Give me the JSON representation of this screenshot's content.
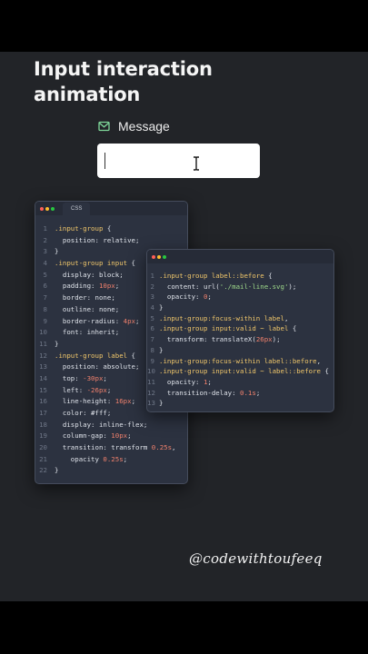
{
  "headline": {
    "line1": "Input interaction",
    "line2": "animation"
  },
  "demo": {
    "label": "Message",
    "label_icon": "mail-icon",
    "input_value": "",
    "cursor_icon": "i-beam-cursor-icon"
  },
  "colors": {
    "background": "#222428",
    "accent_icon": "#7fd89a",
    "window_bg": "#2c3240",
    "selector": "#f1c76a",
    "property": "#dfe3ea",
    "number": "#f0806c",
    "string": "#9ed98a"
  },
  "window1": {
    "tab_label": "CSS",
    "lines": [
      {
        "n": "1",
        "t": [
          {
            "c": "sel",
            "s": ".input-group"
          },
          {
            "c": "punc",
            "s": " {"
          }
        ]
      },
      {
        "n": "2",
        "t": [
          {
            "c": "prop",
            "s": "  position: "
          },
          {
            "c": "val",
            "s": "relative"
          },
          {
            "c": "punc",
            "s": ";"
          }
        ]
      },
      {
        "n": "3",
        "t": [
          {
            "c": "punc",
            "s": "}"
          }
        ]
      },
      {
        "n": "4",
        "t": [
          {
            "c": "sel",
            "s": ".input-group input"
          },
          {
            "c": "punc",
            "s": " {"
          }
        ]
      },
      {
        "n": "5",
        "t": [
          {
            "c": "prop",
            "s": "  display: "
          },
          {
            "c": "val",
            "s": "block"
          },
          {
            "c": "punc",
            "s": ";"
          }
        ]
      },
      {
        "n": "6",
        "t": [
          {
            "c": "prop",
            "s": "  padding: "
          },
          {
            "c": "num",
            "s": "10px"
          },
          {
            "c": "punc",
            "s": ";"
          }
        ]
      },
      {
        "n": "7",
        "t": [
          {
            "c": "prop",
            "s": "  border: "
          },
          {
            "c": "val",
            "s": "none"
          },
          {
            "c": "punc",
            "s": ";"
          }
        ]
      },
      {
        "n": "8",
        "t": [
          {
            "c": "prop",
            "s": "  outline: "
          },
          {
            "c": "val",
            "s": "none"
          },
          {
            "c": "punc",
            "s": ";"
          }
        ]
      },
      {
        "n": "9",
        "t": [
          {
            "c": "prop",
            "s": "  border-radius: "
          },
          {
            "c": "num",
            "s": "4px"
          },
          {
            "c": "punc",
            "s": ";"
          }
        ]
      },
      {
        "n": "10",
        "t": [
          {
            "c": "prop",
            "s": "  font: "
          },
          {
            "c": "val",
            "s": "inherit"
          },
          {
            "c": "punc",
            "s": ";"
          }
        ]
      },
      {
        "n": "11",
        "t": [
          {
            "c": "punc",
            "s": "}"
          }
        ]
      },
      {
        "n": "12",
        "t": [
          {
            "c": "sel",
            "s": ".input-group label"
          },
          {
            "c": "punc",
            "s": " {"
          }
        ]
      },
      {
        "n": "13",
        "t": [
          {
            "c": "prop",
            "s": "  position: "
          },
          {
            "c": "val",
            "s": "absolute"
          },
          {
            "c": "punc",
            "s": ";"
          }
        ]
      },
      {
        "n": "14",
        "t": [
          {
            "c": "prop",
            "s": "  top: "
          },
          {
            "c": "num",
            "s": "-30px"
          },
          {
            "c": "punc",
            "s": ";"
          }
        ]
      },
      {
        "n": "15",
        "t": [
          {
            "c": "prop",
            "s": "  left: "
          },
          {
            "c": "num",
            "s": "-26px"
          },
          {
            "c": "punc",
            "s": ";"
          }
        ]
      },
      {
        "n": "16",
        "t": [
          {
            "c": "prop",
            "s": "  line-height: "
          },
          {
            "c": "num",
            "s": "16px"
          },
          {
            "c": "punc",
            "s": ";"
          }
        ]
      },
      {
        "n": "17",
        "t": [
          {
            "c": "prop",
            "s": "  color: "
          },
          {
            "c": "val",
            "s": "#fff"
          },
          {
            "c": "punc",
            "s": ";"
          }
        ]
      },
      {
        "n": "18",
        "t": [
          {
            "c": "prop",
            "s": "  display: "
          },
          {
            "c": "val",
            "s": "inline-flex"
          },
          {
            "c": "punc",
            "s": ";"
          }
        ]
      },
      {
        "n": "19",
        "t": [
          {
            "c": "prop",
            "s": "  column-gap: "
          },
          {
            "c": "num",
            "s": "10px"
          },
          {
            "c": "punc",
            "s": ";"
          }
        ]
      },
      {
        "n": "20",
        "t": [
          {
            "c": "prop",
            "s": "  transition: "
          },
          {
            "c": "val",
            "s": "transform "
          },
          {
            "c": "num",
            "s": "0.25s"
          },
          {
            "c": "punc",
            "s": ","
          }
        ]
      },
      {
        "n": "21",
        "t": [
          {
            "c": "prop",
            "s": "    opacity "
          },
          {
            "c": "num",
            "s": "0.25s"
          },
          {
            "c": "punc",
            "s": ";"
          }
        ]
      },
      {
        "n": "22",
        "t": [
          {
            "c": "punc",
            "s": "}"
          }
        ]
      }
    ]
  },
  "window2": {
    "lines": [
      {
        "n": "1",
        "t": [
          {
            "c": "sel",
            "s": ".input-group label::before"
          },
          {
            "c": "punc",
            "s": " {"
          }
        ]
      },
      {
        "n": "2",
        "t": [
          {
            "c": "prop",
            "s": "  content: "
          },
          {
            "c": "val",
            "s": "url("
          },
          {
            "c": "str",
            "s": "'./mail-line.svg'"
          },
          {
            "c": "val",
            "s": ")"
          },
          {
            "c": "punc",
            "s": ";"
          }
        ]
      },
      {
        "n": "3",
        "t": [
          {
            "c": "prop",
            "s": "  opacity: "
          },
          {
            "c": "num",
            "s": "0"
          },
          {
            "c": "punc",
            "s": ";"
          }
        ]
      },
      {
        "n": "4",
        "t": [
          {
            "c": "punc",
            "s": "}"
          }
        ]
      },
      {
        "n": "5",
        "t": [
          {
            "c": "sel",
            "s": ".input-group"
          },
          {
            "c": "pseudo",
            "s": ":focus-within"
          },
          {
            "c": "sel",
            "s": " label"
          },
          {
            "c": "punc",
            "s": ","
          }
        ]
      },
      {
        "n": "6",
        "t": [
          {
            "c": "sel",
            "s": ".input-group input"
          },
          {
            "c": "pseudo",
            "s": ":valid"
          },
          {
            "c": "sel",
            "s": " ~ label"
          },
          {
            "c": "punc",
            "s": " {"
          }
        ]
      },
      {
        "n": "7",
        "t": [
          {
            "c": "prop",
            "s": "  transform: "
          },
          {
            "c": "val",
            "s": "translateX("
          },
          {
            "c": "num",
            "s": "26px"
          },
          {
            "c": "val",
            "s": ")"
          },
          {
            "c": "punc",
            "s": ";"
          }
        ]
      },
      {
        "n": "8",
        "t": [
          {
            "c": "punc",
            "s": "}"
          }
        ]
      },
      {
        "n": "9",
        "t": [
          {
            "c": "sel",
            "s": ".input-group"
          },
          {
            "c": "pseudo",
            "s": ":focus-within"
          },
          {
            "c": "sel",
            "s": " label::before"
          },
          {
            "c": "punc",
            "s": ","
          }
        ]
      },
      {
        "n": "10",
        "t": [
          {
            "c": "sel",
            "s": ".input-group input"
          },
          {
            "c": "pseudo",
            "s": ":valid"
          },
          {
            "c": "sel",
            "s": " ~ label::before"
          },
          {
            "c": "punc",
            "s": " {"
          }
        ]
      },
      {
        "n": "11",
        "t": [
          {
            "c": "prop",
            "s": "  opacity: "
          },
          {
            "c": "num",
            "s": "1"
          },
          {
            "c": "punc",
            "s": ";"
          }
        ]
      },
      {
        "n": "12",
        "t": [
          {
            "c": "prop",
            "s": "  transition-delay: "
          },
          {
            "c": "num",
            "s": "0.1s"
          },
          {
            "c": "punc",
            "s": ";"
          }
        ]
      },
      {
        "n": "13",
        "t": [
          {
            "c": "punc",
            "s": "}"
          }
        ]
      }
    ]
  },
  "signature": "@codewithtoufeeq"
}
